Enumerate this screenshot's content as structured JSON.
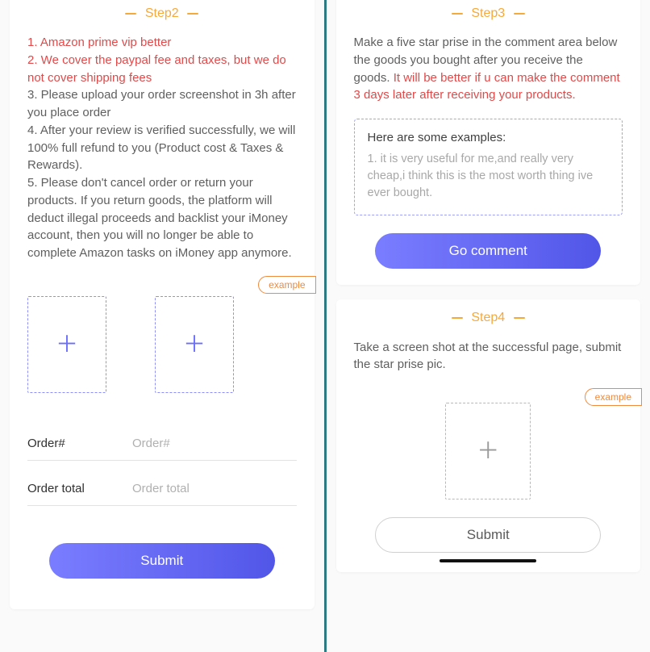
{
  "step2": {
    "label": "Step2",
    "red_line1": "1. Amazon prime vip better",
    "red_line2": "2. We cover the paypal fee and taxes, but we do not cover shipping fees",
    "line3": "3. Please upload your order screenshot in 3h after you place order",
    "line4": "4. After your review is verified successfully, we will 100% full refund to you (Product cost & Taxes & Rewards).",
    "line5": "5. Please don't cancel order or return your products. If you return goods, the platform will deduct illegal proceeds and backlist your iMoney account, then you will no longer be able to complete Amazon tasks on iMoney app anymore.",
    "example_tag": "example",
    "order_label": "Order#",
    "order_placeholder": "Order#",
    "total_label": "Order total",
    "total_placeholder": "Order total",
    "submit": "Submit"
  },
  "step3": {
    "label": "Step3",
    "text_plain": "Make a five star prise in the comment area below the goods you bought after you receive the goods. ",
    "text_red": "It will be better if u can make the comment 3 days later after receiving your products.",
    "examples_title": "Here are some examples:",
    "example1": "1. it is very useful for me,and really very cheap,i think this is the most worth thing ive ever bought.",
    "go_comment": "Go comment"
  },
  "step4": {
    "label": "Step4",
    "text": "Take a screen shot at the successful page, submit the star prise pic.",
    "example_tag": "example",
    "submit": "Submit"
  }
}
